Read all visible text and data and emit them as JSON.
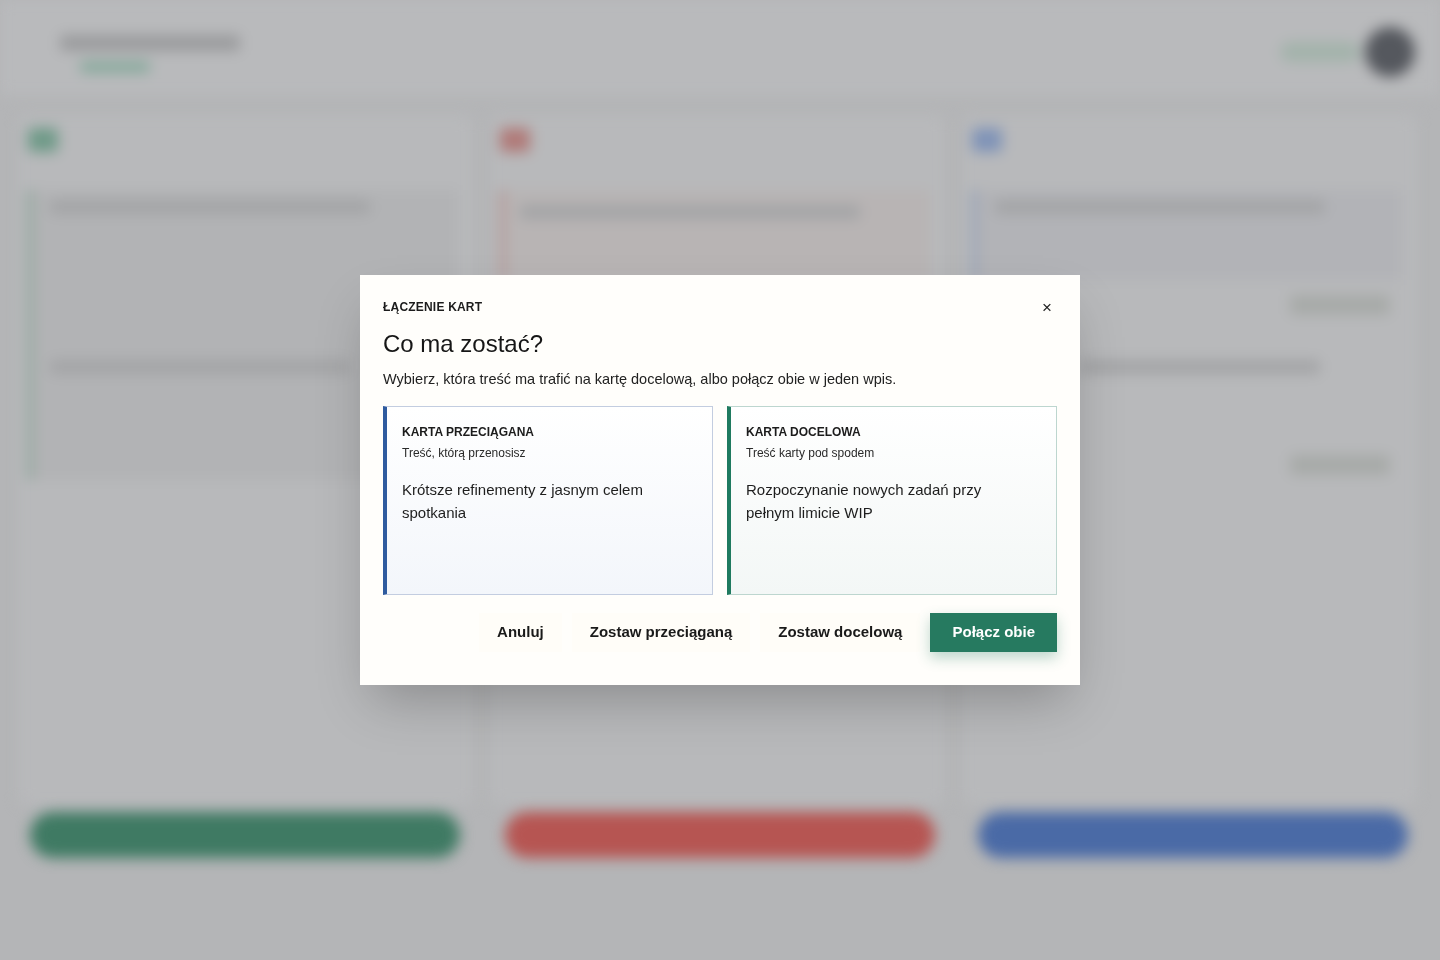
{
  "dialog": {
    "eyebrow": "ŁĄCZENIE KART",
    "close": "×",
    "title": "Co ma zostać?",
    "description": "Wybierz, która treść ma trafić na kartę docelową, albo połącz obie w jeden wpis.",
    "cards": [
      {
        "kind": "dragged",
        "heading": "KARTA PRZECIĄGANA",
        "subheading": "Treść, którą przenosisz",
        "text": "Krótsze refinementy z jasnym celem spotkania",
        "color": "#2f5b9f"
      },
      {
        "kind": "target",
        "heading": "KARTA DOCELOWA",
        "subheading": "Treść karty pod spodem",
        "text": "Rozpoczynanie nowych zadań przy pełnym limicie WIP",
        "color": "#1f7a5f"
      }
    ],
    "buttons": [
      {
        "label": "Anuluj",
        "kind": "text"
      },
      {
        "label": "Zostaw przeciąganą",
        "kind": "text"
      },
      {
        "label": "Zostaw docelową",
        "kind": "text"
      },
      {
        "label": "Połącz obie",
        "kind": "primary"
      }
    ]
  }
}
